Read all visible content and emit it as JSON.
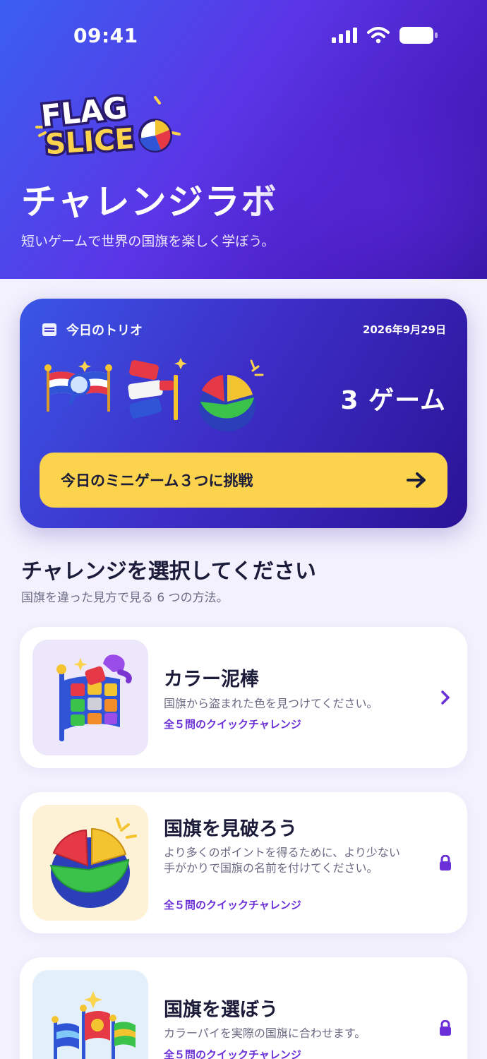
{
  "status_bar": {
    "time": "09:41"
  },
  "logo": {
    "text_line1": "FLAG",
    "text_line2": "SLICE"
  },
  "header": {
    "title": "チャレンジラボ",
    "subtitle": "短いゲームで世界の国旗を楽しく学ぼう。"
  },
  "daily_trio": {
    "label": "今日のトリオ",
    "date": "2026年9月29日",
    "count": "3 ゲーム",
    "button_label": "今日のミニゲーム３つに挑戦"
  },
  "challenges_section": {
    "title": "チャレンジを選択してください",
    "subtitle": "国旗を違った見方で見る 6 つの方法。"
  },
  "challenges": [
    {
      "title": "カラー泥棒",
      "description": "国旗から盗まれた色を見つけてください。",
      "meta": "全５問のクイックチャレンジ",
      "state": "open",
      "icon": "paint-flag-icon",
      "bg_color": "#ece7fb"
    },
    {
      "title": "国旗を見破ろう",
      "description": "より多くのポイントを得るために、より少ない手がかりで国旗の名前を付けてください。",
      "meta": "全５問のクイックチャレンジ",
      "state": "locked",
      "icon": "color-pie-icon",
      "bg_color": "#fdf1d6"
    },
    {
      "title": "国旗を選ぼう",
      "description": "カラーパイを実際の国旗に合わせます。",
      "meta": "全５問のクイックチャレンジ",
      "state": "locked",
      "icon": "flags-group-icon",
      "bg_color": "#e3f0fb"
    }
  ],
  "colors": {
    "accent": "#6a2fd6",
    "cta_yellow": "#fcd34d",
    "hero_blue": "#3a5ff0",
    "hero_purple": "#5b35e6"
  }
}
